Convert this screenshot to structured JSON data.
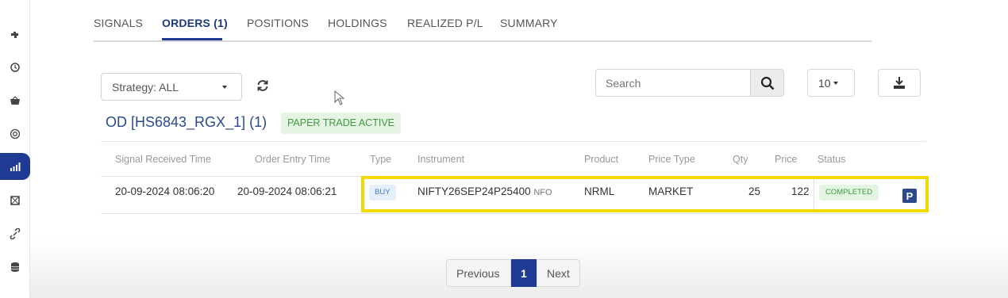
{
  "sidebar": {
    "icons": [
      "puzzle-icon",
      "history-icon",
      "basket-icon",
      "target-icon",
      "signal-bars-icon",
      "screen-icon",
      "link-icon",
      "database-icon"
    ],
    "active_index": 4,
    "accent_color": "#1f3a93"
  },
  "tabs": [
    {
      "label": "SIGNALS"
    },
    {
      "label": "ORDERS (1)"
    },
    {
      "label": "POSITIONS"
    },
    {
      "label": "HOLDINGS"
    },
    {
      "label": "REALIZED P/L"
    },
    {
      "label": "SUMMARY"
    }
  ],
  "active_tab": "ORDERS (1)",
  "controls": {
    "strategy_label": "Strategy: ALL",
    "search_placeholder": "Search",
    "page_size": "10"
  },
  "section": {
    "title": "OD [HS6843_RGX_1] (1)",
    "badge": "PAPER TRADE ACTIVE"
  },
  "table": {
    "headers": {
      "signal_time": "Signal Received Time",
      "entry_time": "Order Entry Time",
      "type": "Type",
      "instrument": "Instrument",
      "product": "Product",
      "price_type": "Price Type",
      "qty": "Qty",
      "price": "Price",
      "status": "Status"
    },
    "rows": [
      {
        "signal_time": "20-09-2024 08:06:20",
        "entry_time": "20-09-2024 08:06:21",
        "type": "BUY",
        "instrument": "NIFTY26SEP24P25400",
        "exchange": "NFO",
        "product": "NRML",
        "price_type": "MARKET",
        "qty": "25",
        "price": "122",
        "status": "COMPLETED",
        "action_icon": "P"
      }
    ]
  },
  "pagination": {
    "previous": "Previous",
    "current": "1",
    "next": "Next"
  },
  "colors": {
    "highlight": "#f2d900",
    "paper_badge_bg": "#e6f4e4",
    "completed_green": "#3c9d3c"
  }
}
